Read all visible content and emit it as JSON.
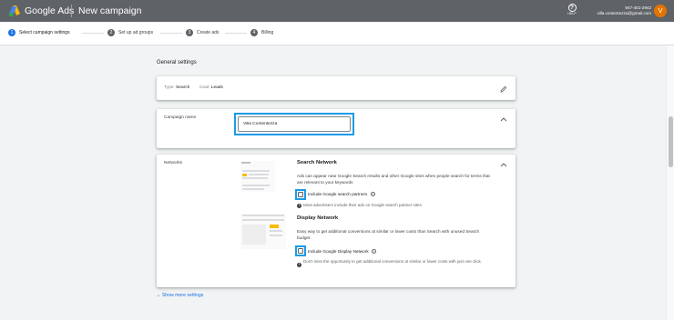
{
  "header": {
    "brand": "Google Ads",
    "page_title": "New campaign",
    "help_label": "HELP",
    "help_glyph": "?",
    "account_phone": "947-401-2942",
    "account_email": "villa.contentezza@gmail.com",
    "avatar_initial": "V",
    "colors": {
      "bar": "#5f6368",
      "avatar": "#e37400"
    }
  },
  "stepper": {
    "steps": [
      {
        "num": "1",
        "label": "Select campaign settings",
        "active": true
      },
      {
        "num": "2",
        "label": "Set up ad groups",
        "active": false
      },
      {
        "num": "3",
        "label": "Create ads",
        "active": false
      },
      {
        "num": "4",
        "label": "Billing",
        "active": false
      }
    ],
    "active_color": "#1a73e8"
  },
  "main": {
    "section_title": "General settings",
    "summary": {
      "type_label": "Type:",
      "type_value": "Search",
      "goal_label": "Goal:",
      "goal_value": "Leads",
      "edit_icon": "pencil-icon"
    },
    "campaign_name": {
      "label": "Campaign name",
      "value": "Villa Contentezza",
      "collapse_icon": "chevron-up-icon"
    },
    "networks": {
      "label": "Networks",
      "collapse_icon": "chevron-up-icon",
      "search": {
        "title": "Search Network",
        "description": "Ads can appear near Google Search results and other Google sites when people search for terms that are relevant to your keywords",
        "checkbox_label": "Include Google search partners",
        "checked": false,
        "note": "Most advertisers include their ads on Google search partner sites"
      },
      "display": {
        "title": "Display Network",
        "description": "Easy way to get additional conversions at similar or lower costs than Search with unused Search budget.",
        "checkbox_label": "Include Google Display Network",
        "checked": false,
        "note": "Don't miss the opportunity to get additional conversions at similar or lower costs with just one click."
      },
      "highlight_color": "#1a9be6"
    },
    "show_more": "Show more settings"
  }
}
